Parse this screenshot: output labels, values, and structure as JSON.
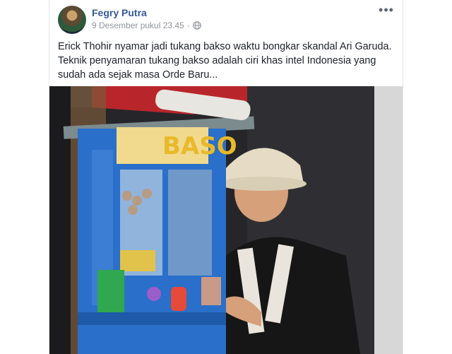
{
  "post": {
    "author": "Fegry Putra",
    "timestamp": "9 Desember pukul 23.45",
    "privacy_icon": "globe-icon",
    "more_icon": "more-horizontal-icon",
    "text_lines": [
      "Erick Thohir nyamar jadi tukang bakso waktu bongkar skandal Ari Garuda.",
      "Teknik penyamaran tukang bakso adalah ciri khas intel Indonesia yang",
      "sudah ada sejak masa Orde Baru..."
    ]
  },
  "photo": {
    "cart_sign": "BASO"
  },
  "colors": {
    "author_link": "#365899",
    "meta_text": "#90949c",
    "body_text": "#1d2129",
    "cart_blue": "#2a6fc9",
    "sign_yellow": "#e8b92a"
  }
}
